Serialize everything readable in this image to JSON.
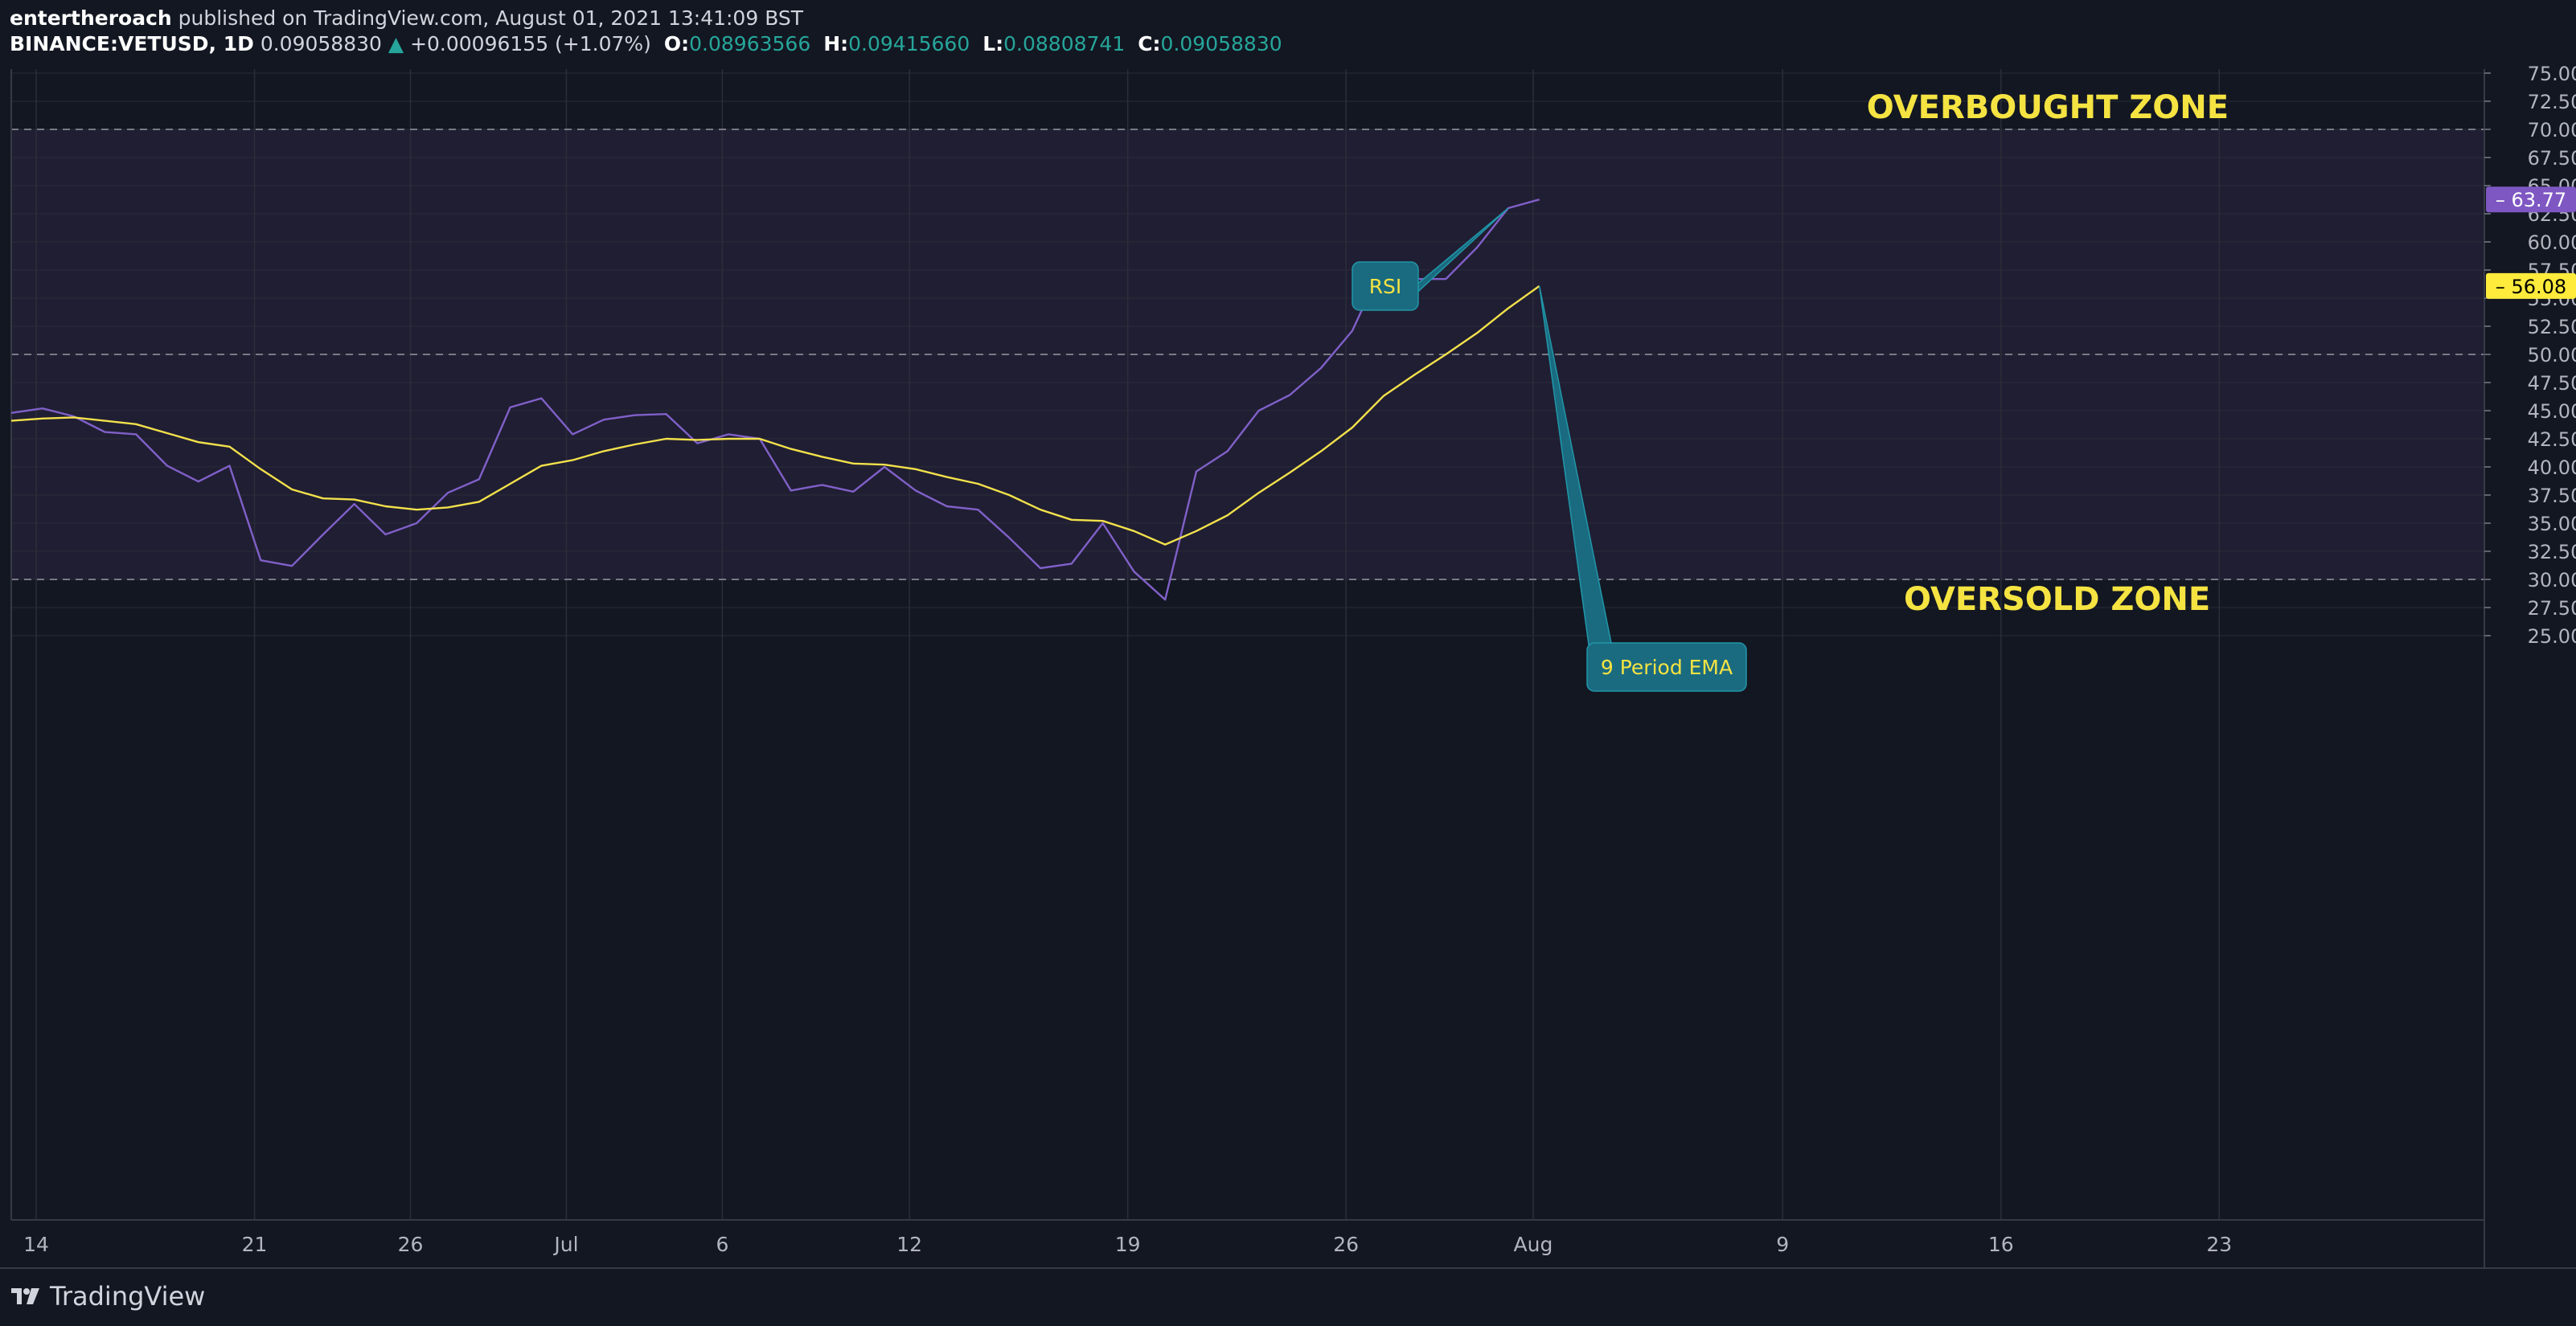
{
  "header": {
    "author": "entertheroach",
    "published": "published on TradingView.com, August 01, 2021 13:41:09 BST",
    "symbol": "BINANCE:VETUSD, 1D",
    "price": "0.09058830",
    "change": "+0.00096155 (+1.07%)",
    "open_label": "O:",
    "open": "0.08963566",
    "high_label": "H:",
    "high": "0.09415660",
    "low_label": "L:",
    "low": "0.08808741",
    "close_label": "C:",
    "close": "0.09058830"
  },
  "branding": {
    "logo_text": "TradingView"
  },
  "colors": {
    "background": "#131722",
    "band": "#201e33",
    "rsi": "#8060c8",
    "ema": "#f2e14b",
    "zone_text": "#f5e342",
    "callout": "#1a6b80",
    "rsi_badge": "#7e57c2",
    "ema_badge": "#ffeb3b"
  },
  "chart_data": {
    "type": "line",
    "ylim": [
      24,
      75
    ],
    "y_ticks": [
      "25.00",
      "27.50",
      "30.00",
      "32.50",
      "35.00",
      "37.50",
      "40.00",
      "42.50",
      "45.00",
      "47.50",
      "50.00",
      "52.50",
      "55.00",
      "57.50",
      "60.00",
      "62.50",
      "65.00",
      "67.50",
      "70.00",
      "72.50",
      "75.00"
    ],
    "x_ticks": [
      "14",
      "21",
      "26",
      "Jul",
      "6",
      "12",
      "19",
      "26",
      "Aug",
      "9",
      "16",
      "23"
    ],
    "x_tick_days": [
      0,
      7,
      12,
      17,
      22,
      28,
      35,
      42,
      48,
      56,
      63,
      70
    ],
    "x_range_days": [
      -0.8,
      78.5
    ],
    "levels": [
      70,
      50,
      30
    ],
    "zone_labels": [
      {
        "text": "OVERBOUGHT ZONE",
        "y": 72.0,
        "day": 64.5
      },
      {
        "text": "OVERSOLD ZONE",
        "y": 28.3,
        "day": 64.8
      }
    ],
    "series": [
      {
        "name": "RSI",
        "day_start": -0.8,
        "values": [
          44.8,
          45.2,
          44.5,
          43.1,
          42.9,
          40.1,
          38.7,
          40.1,
          31.7,
          31.2,
          34.0,
          36.7,
          34.0,
          35.0,
          37.7,
          38.9,
          45.3,
          46.1,
          42.9,
          44.2,
          44.6,
          44.7,
          42.1,
          42.9,
          42.5,
          37.9,
          38.4,
          37.8,
          40.0,
          37.9,
          36.5,
          36.2,
          33.7,
          31.0,
          31.4,
          35.0,
          30.7,
          28.2,
          39.6,
          41.4,
          45.0,
          46.4,
          48.8,
          52.1,
          58.1,
          56.7,
          56.7,
          59.5,
          63.0,
          63.77
        ]
      },
      {
        "name": "9 Period EMA",
        "day_start": -0.8,
        "values": [
          44.1,
          44.3,
          44.4,
          44.1,
          43.8,
          43.0,
          42.2,
          41.8,
          39.8,
          38.0,
          37.2,
          37.1,
          36.5,
          36.2,
          36.4,
          36.9,
          38.5,
          40.1,
          40.6,
          41.4,
          42.0,
          42.5,
          42.4,
          42.5,
          42.5,
          41.6,
          40.9,
          40.3,
          40.2,
          39.8,
          39.1,
          38.5,
          37.5,
          36.2,
          35.3,
          35.2,
          34.3,
          33.1,
          34.3,
          35.7,
          37.7,
          39.5,
          41.4,
          43.5,
          46.3,
          48.2,
          50.0,
          51.9,
          54.1,
          56.08
        ]
      }
    ],
    "last_value_labels": [
      {
        "series": "RSI",
        "text": "63.77"
      },
      {
        "series": "9 Period EMA",
        "text": "56.08"
      }
    ],
    "annotations": [
      {
        "text": "RSI",
        "target_series": "RSI",
        "target_index": 48
      },
      {
        "text": "9 Period EMA",
        "target_series": "9 Period EMA",
        "target_index": 49
      }
    ]
  }
}
